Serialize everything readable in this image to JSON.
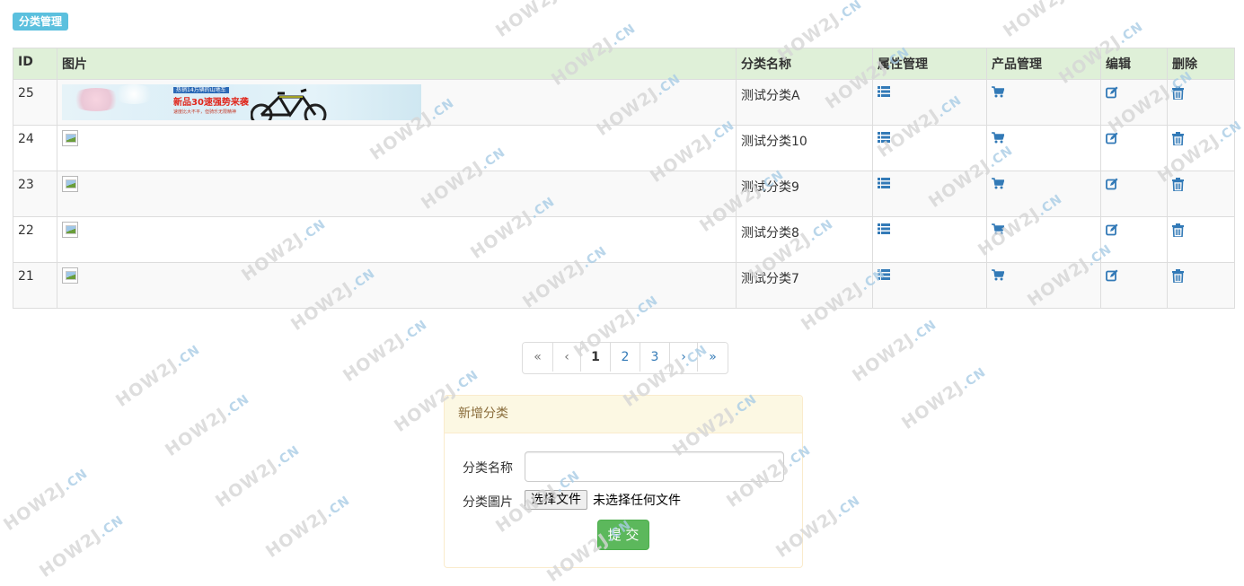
{
  "page": {
    "title_badge": "分类管理"
  },
  "table": {
    "headers": [
      "ID",
      "图片",
      "分类名称",
      "属性管理",
      "产品管理",
      "编辑",
      "删除"
    ],
    "rows": [
      {
        "id": "25",
        "name": "测试分类A",
        "image": "banner"
      },
      {
        "id": "24",
        "name": "测试分类10",
        "image": "broken"
      },
      {
        "id": "23",
        "name": "测试分类9",
        "image": "broken"
      },
      {
        "id": "22",
        "name": "测试分类8",
        "image": "broken"
      },
      {
        "id": "21",
        "name": "测试分类7",
        "image": "broken"
      }
    ],
    "icons": {
      "property": "list-icon",
      "product": "shopping-cart-icon",
      "edit": "edit-icon",
      "delete": "trash-icon"
    },
    "banner": {
      "tag": "热销14万辆的山地车",
      "headline": "新品30速强势来袭",
      "sub": "速度比大不平，但骑乐无限精神"
    }
  },
  "pagination": {
    "first": "«",
    "prev": "‹",
    "pages": [
      "1",
      "2",
      "3"
    ],
    "active_page": "1",
    "next": "›",
    "last": "»"
  },
  "form": {
    "heading": "新增分类",
    "name_label": "分类名称",
    "name_value": "",
    "image_label": "分类圖片",
    "file_button": "选择文件",
    "file_status": "未选择任何文件",
    "submit": "提 交"
  },
  "watermark": {
    "text": "HOW2J",
    "suffix": ".CN"
  },
  "colors": {
    "header_bg": "#dff0d8",
    "badge_bg": "#5bc0de",
    "panel_bg": "#fcf8e3",
    "submit_bg": "#5cb85c",
    "link": "#337ab7"
  }
}
